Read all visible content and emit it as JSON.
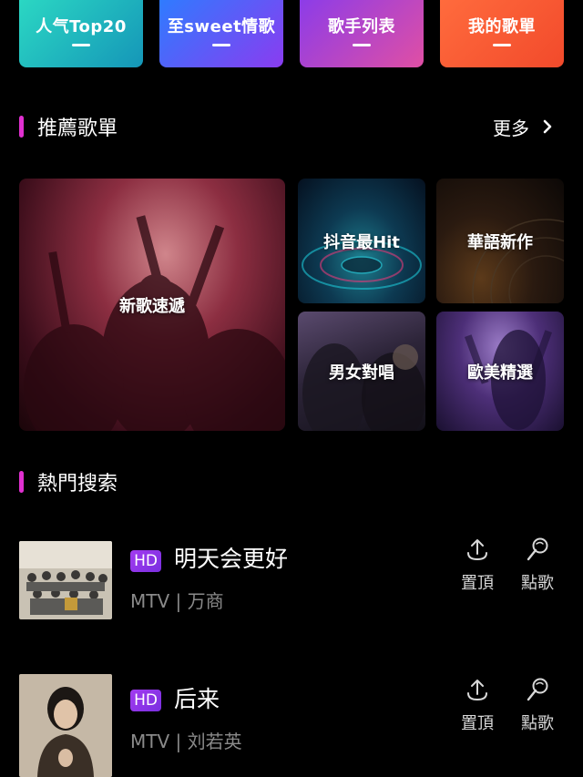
{
  "tabs": [
    {
      "label": "人气Top20"
    },
    {
      "label": "至sweet情歌"
    },
    {
      "label": "歌手列表"
    },
    {
      "label": "我的歌單"
    }
  ],
  "recommended": {
    "title": "推薦歌單",
    "more_label": "更多",
    "playlists": [
      {
        "label": "新歌速遞"
      },
      {
        "label": "抖音最Hit"
      },
      {
        "label": "華語新作"
      },
      {
        "label": "男女對唱"
      },
      {
        "label": "歐美精選"
      }
    ]
  },
  "hot_search": {
    "title": "熱門搜索",
    "songs": [
      {
        "badge": "HD",
        "title": "明天会更好",
        "subtitle": "MTV | 万商",
        "pin_label": "置頂",
        "order_label": "點歌"
      },
      {
        "badge": "HD",
        "title": "后来",
        "subtitle": "MTV | 刘若英",
        "pin_label": "置頂",
        "order_label": "點歌"
      }
    ]
  },
  "colors": {
    "accent_bar": "#e030d0",
    "hd_badge": "#8f35e8",
    "background": "#000000"
  },
  "icons": [
    "chevron-right-icon",
    "pin-top-icon",
    "microphone-icon"
  ]
}
